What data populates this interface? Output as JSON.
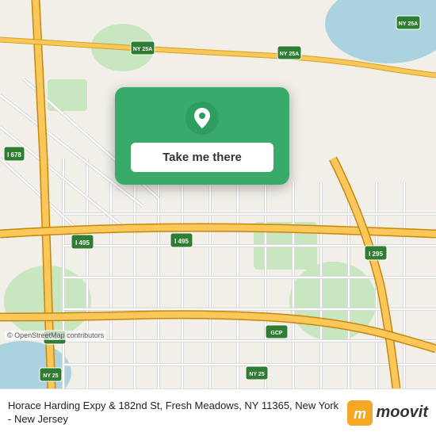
{
  "map": {
    "alt": "Map of Fresh Meadows, Queens, NY area"
  },
  "card": {
    "button_label": "Take me there"
  },
  "bottom_bar": {
    "address": "Horace Harding Expy & 182nd St, Fresh Meadows,\nNY 11365, New York - New Jersey",
    "osm_credit": "© OpenStreetMap contributors",
    "moovit_label": "moovit"
  }
}
